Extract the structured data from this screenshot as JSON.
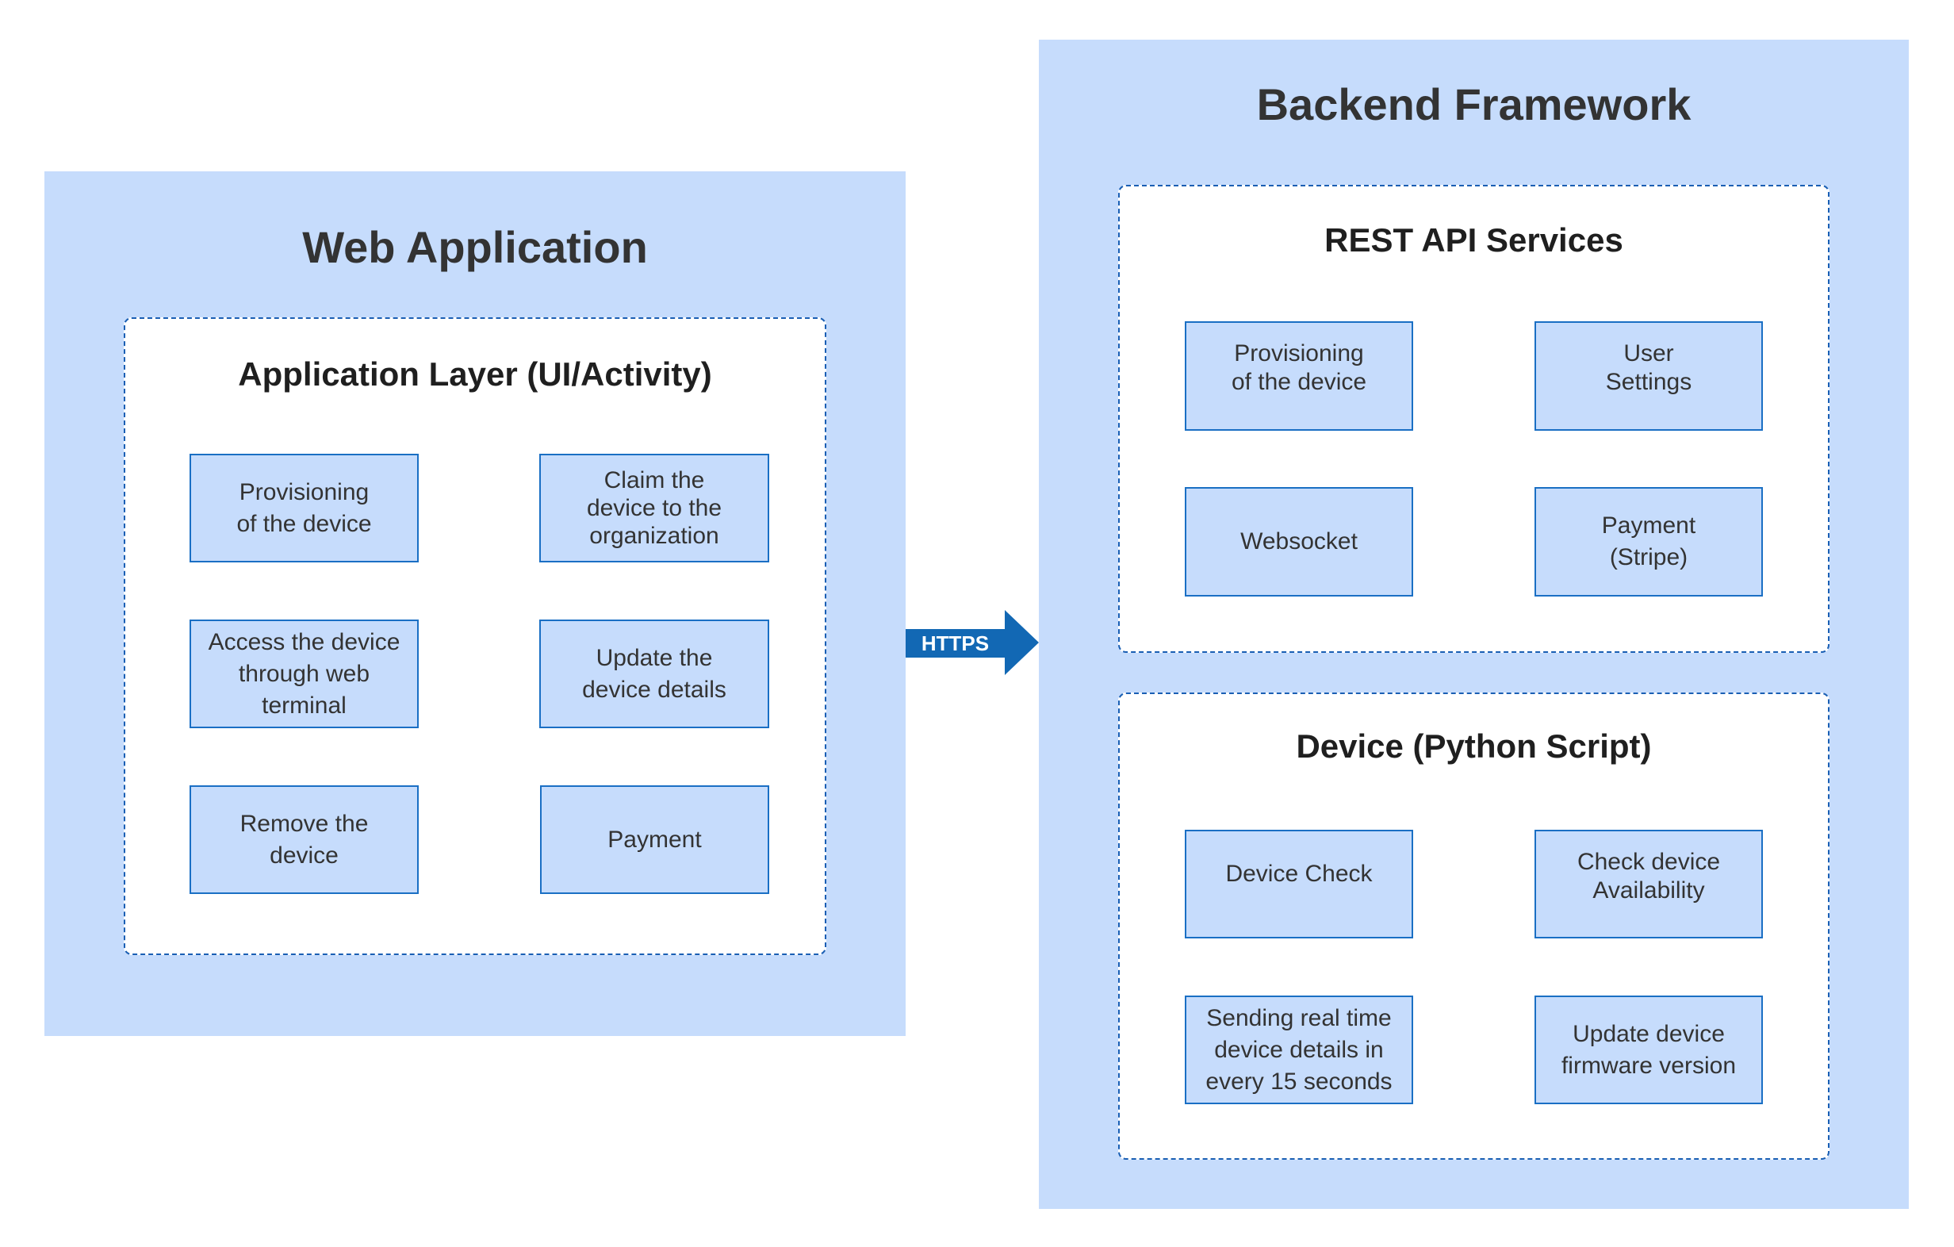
{
  "colors": {
    "panel_fill": "#C6DCFC",
    "node_border": "#1A6FC4",
    "group_border": "#1A5FB4",
    "arrow": "#1268B4",
    "title_text": "#333333"
  },
  "web_application": {
    "title": "Web Application",
    "application_layer": {
      "title": "Application Layer (UI/Activity)",
      "items": [
        {
          "label": "Provisioning\nof the device"
        },
        {
          "label": "Claim the\ndevice to the\norganization"
        },
        {
          "label": "Access the device\nthrough web\nterminal"
        },
        {
          "label": "Update the\ndevice details"
        },
        {
          "label": "Remove the\ndevice"
        },
        {
          "label": "Payment"
        }
      ]
    }
  },
  "connector": {
    "label": "HTTPS",
    "icon": "arrow-right-icon",
    "direction": "web-application-to-backend"
  },
  "backend_framework": {
    "title": "Backend Framework",
    "rest_api": {
      "title": "REST API Services",
      "items": [
        {
          "label": "Provisioning\nof the device"
        },
        {
          "label": "User\nSettings"
        },
        {
          "label": "Websocket"
        },
        {
          "label": "Payment\n(Stripe)"
        }
      ]
    },
    "device": {
      "title": "Device (Python Script)",
      "items": [
        {
          "label": "Device Check"
        },
        {
          "label": "Check device\nAvailability"
        },
        {
          "label": "Sending real time\ndevice details in\nevery 15 seconds"
        },
        {
          "label": "Update device\nfirmware version"
        }
      ]
    }
  }
}
